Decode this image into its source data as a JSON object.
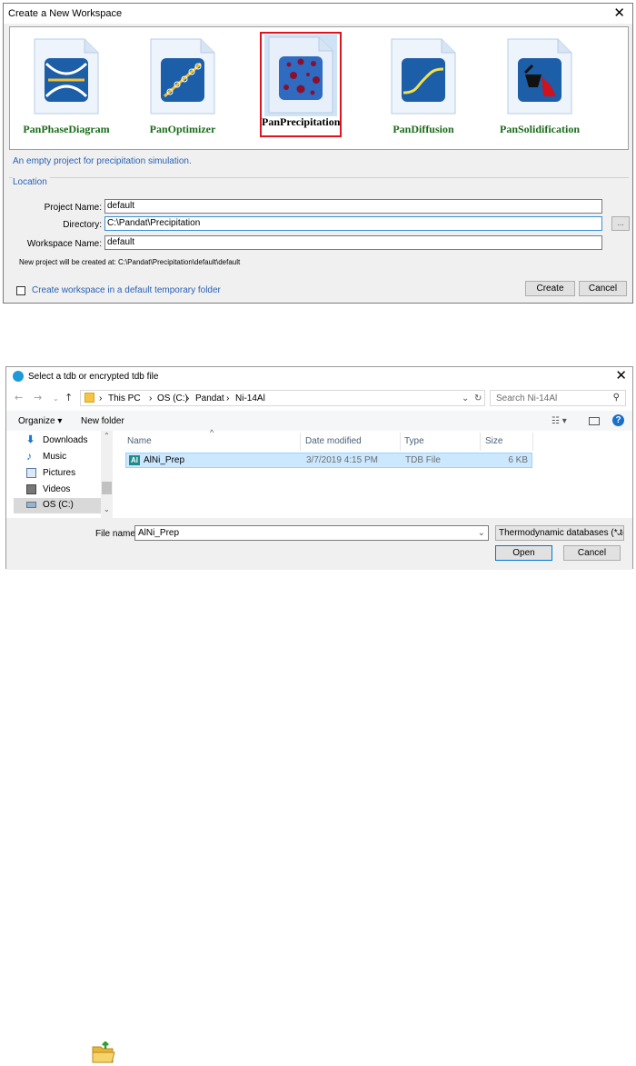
{
  "workspace_dialog": {
    "title": "Create a New Workspace",
    "close_glyph": "✕",
    "templates": [
      {
        "label": "PanPhaseDiagram",
        "icon": "phase-diagram-icon"
      },
      {
        "label": "PanOptimizer",
        "icon": "optimizer-icon"
      },
      {
        "label": "PanPrecipitation",
        "icon": "precipitation-icon",
        "selected": true
      },
      {
        "label": "PanDiffusion",
        "icon": "diffusion-icon"
      },
      {
        "label": "PanSolidification",
        "icon": "solidification-icon"
      }
    ],
    "description": "An empty project for precipitation simulation.",
    "location_legend": "Location",
    "project_name_label": "Project Name:",
    "project_name_value": "default",
    "directory_label": "Directory:",
    "directory_value": "C:\\Pandat\\Precipitation",
    "browse_label": "...",
    "workspace_name_label": "Workspace Name:",
    "workspace_name_value": "default",
    "new_project_note": "New project will be created at: C:\\Pandat\\Precipitation\\default\\default",
    "temp_folder_label": "Create workspace in a default temporary folder",
    "create_label": "Create",
    "cancel_label": "Cancel",
    "colors": {
      "selection": "#e0141e",
      "label_green": "#1a6b1a",
      "link_blue": "#2a62b5"
    }
  },
  "file_dialog": {
    "title": "Select a tdb or encrypted tdb file",
    "close_glyph": "✕",
    "breadcrumb": [
      "This PC",
      "OS (C:)",
      "Pandat",
      "Ni-14Al"
    ],
    "search_placeholder": "Search Ni-14Al",
    "organize_label": "Organize ▾",
    "new_folder_label": "New folder",
    "nav_items": [
      {
        "label": "Downloads",
        "icon": "download-icon"
      },
      {
        "label": "Music",
        "icon": "music-icon"
      },
      {
        "label": "Pictures",
        "icon": "pictures-icon"
      },
      {
        "label": "Videos",
        "icon": "videos-icon"
      },
      {
        "label": "OS (C:)",
        "icon": "drive-icon",
        "selected": true
      }
    ],
    "columns": [
      "Name",
      "Date modified",
      "Type",
      "Size"
    ],
    "files": [
      {
        "name": "AlNi_Prep",
        "date": "3/7/2019 4:15 PM",
        "type": "TDB File",
        "size": "6 KB"
      }
    ],
    "file_name_label": "File name:",
    "file_name_value": "AlNi_Prep",
    "file_type_value": "Thermodynamic databases (*.td",
    "open_label": "Open",
    "cancel_label": "Cancel"
  }
}
